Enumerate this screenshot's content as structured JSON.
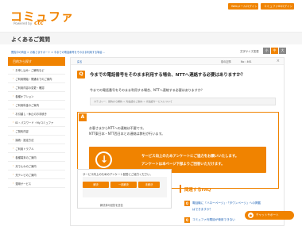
{
  "header": {
    "logo": "コミュファ",
    "logo_sub": "Powered by",
    "logo_ctc": "ctc",
    "buttons": [
      "Webメールログイン",
      "コミュファIDログイン"
    ]
  },
  "page_title": "よくあるご質問",
  "breadcrumb": "閲覧中の商品 > お客さまサポート > 今までの電話番号をそのまま利用する場合…",
  "font_size": {
    "label": "文字サイズ変更",
    "buttons": [
      "小",
      "中",
      "大"
    ]
  },
  "sidebar": {
    "heading": "目的から探す",
    "items": [
      "お申し込み・ご解約など",
      "ご利用開始・開通までのご案内",
      "ご利用内容の変更・確認",
      "各種オプション",
      "ご利用料金のご案内",
      "お引越し・休止のお手続き",
      "ID・パスワード・Myコミュファ",
      "ご契約内容",
      "接続・設定方法",
      "ご利用トラブル",
      "各種端末のご案内",
      "光でんわのご案内",
      "光テレビのご案内",
      "運用サービス"
    ]
  },
  "main": {
    "back": "戻る",
    "prev": "前の記事",
    "num": "No：461",
    "question_title": "今までの電話番号をそのまま利用する場合、NTTへ連絡する必要はありますか？",
    "question_body": "今までの電話番号をそのまま利用する場合、NTTへ連絡する必要はありますか？",
    "category": "カテゴリー：契約から解約 > 光電話のご案内 > 光電話サービスについて",
    "answer_lines": [
      "お客さまからNTTへの連絡は不要です。",
      "NTT東日本・NTT西日本との連絡は弊社が行います。"
    ],
    "banner_line1": "サービス向上のためアンケートにご協力をお願いいたします。",
    "banner_line2": "アンケートは本ページ下部よりご回答いただけます。",
    "survey": {
      "title": "サービス向上のためのアンケート回答にご協力ください。",
      "buttons": [
        "解決",
        "一部解決",
        "未解決"
      ],
      "note": "解決済み回答を送信"
    },
    "related": {
      "heading": "関連するFAQ",
      "q_items": [
        "電話機に「ハローページ」・「タウンページ」への掲載",
        "はできますか？",
        "コミュファ光電話が使用できない"
      ]
    }
  },
  "chat": {
    "label": "チャットサポート"
  },
  "colors": {
    "accent": "#f08300",
    "link": "#1a5fb4"
  }
}
